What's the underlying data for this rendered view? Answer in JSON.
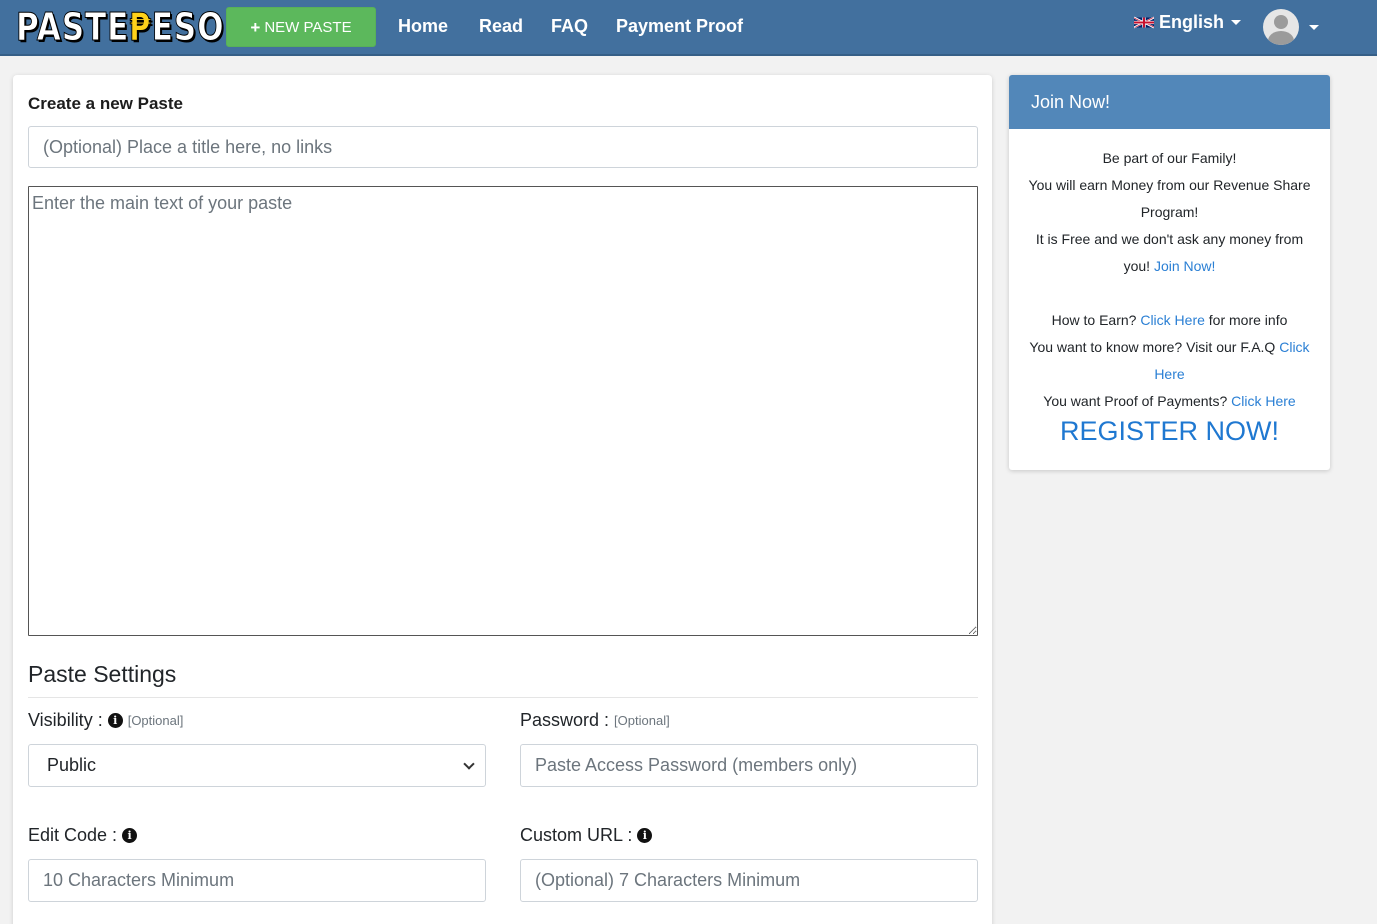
{
  "navbar": {
    "logo_part1": "PASTE",
    "logo_peso": "₱",
    "logo_part2": "ESO",
    "new_paste": "NEW PASTE",
    "links": [
      "Home",
      "Read",
      "FAQ",
      "Payment Proof"
    ],
    "language": "English"
  },
  "form": {
    "heading": "Create a new Paste",
    "title_placeholder": "(Optional) Place a title here, no links",
    "text_placeholder": "Enter the main text of your paste"
  },
  "settings": {
    "heading": "Paste Settings",
    "visibility_label": "Visibility :",
    "optional_tag": "[Optional]",
    "visibility_value": "Public",
    "password_label": "Password :",
    "password_placeholder": "Paste Access Password (members only)",
    "edit_code_label": "Edit Code :",
    "edit_code_placeholder": "10 Characters Minimum",
    "custom_url_label": "Custom URL :",
    "custom_url_placeholder": "(Optional) 7 Characters Minimum"
  },
  "sidebar": {
    "header": "Join Now!",
    "line1": "Be part of our Family!",
    "line2": "You will earn Money from our Revenue Share Program!",
    "line3_pre": "It is Free and we don't ask any money from you!",
    "join_link": "Join Now!",
    "earn_pre": "How to Earn?",
    "click_here": "Click Here",
    "earn_post": "for more info",
    "faq_pre": "You want to know more? Visit our F.A.Q",
    "proof_pre": "You want Proof of Payments?",
    "register": "REGISTER NOW!"
  },
  "icons": {
    "flag": "uk-flag-icon",
    "info": "info-circle-icon",
    "avatar": "user-avatar-icon"
  },
  "colors": {
    "navbar": "#42709e",
    "new_paste_button": "#5cb85c",
    "sidebar_header": "#5287b9",
    "link": "#2a7fd4"
  }
}
